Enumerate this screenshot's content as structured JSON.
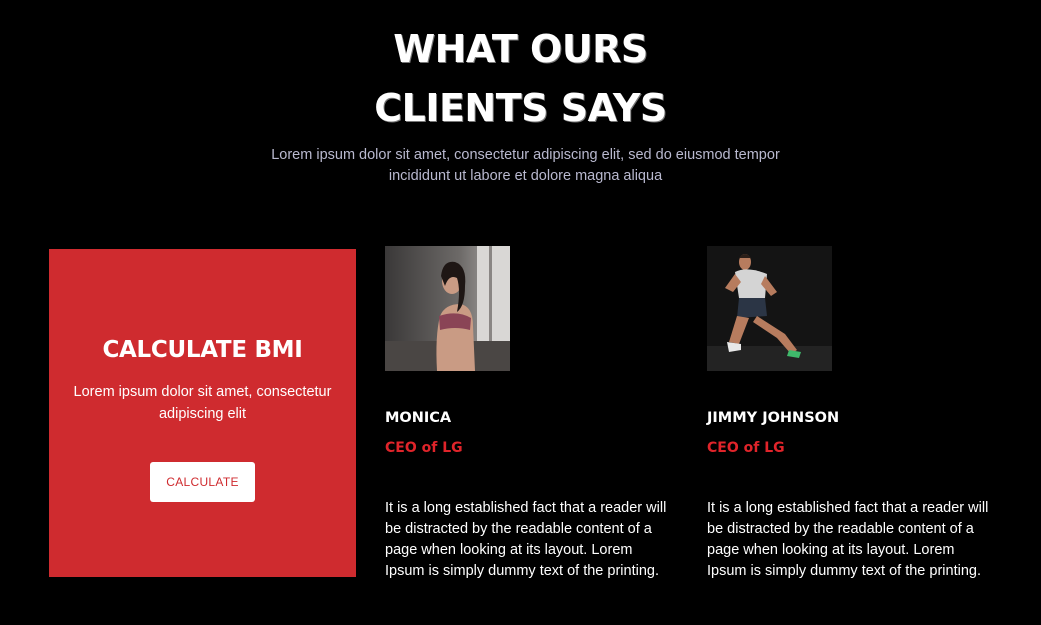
{
  "section": {
    "title_line1": "WHAT OURS",
    "title_line2": "CLIENTS SAYS",
    "subtitle": "Lorem ipsum dolor sit amet, consectetur adipiscing elit, sed do eiusmod tempor incididunt ut labore et dolore magna aliqua"
  },
  "bmi": {
    "title": "CALCULATE BMI",
    "text": "Lorem ipsum dolor sit amet, consectetur adipiscing elit",
    "button_label": "CALCULATE",
    "color": "#cf2b2f"
  },
  "testimonials": [
    {
      "name": "MONICA",
      "role": "CEO of LG",
      "quote": "It is a long established fact that a reader will be distracted by the readable content of a page when looking at its layout. Lorem Ipsum is simply dummy text of the printing."
    },
    {
      "name": "JIMMY JOHNSON",
      "role": "CEO of LG",
      "quote": "It is a long established fact that a reader will be distracted by the readable content of a page when looking at its layout. Lorem Ipsum is simply dummy text of the printing."
    }
  ]
}
